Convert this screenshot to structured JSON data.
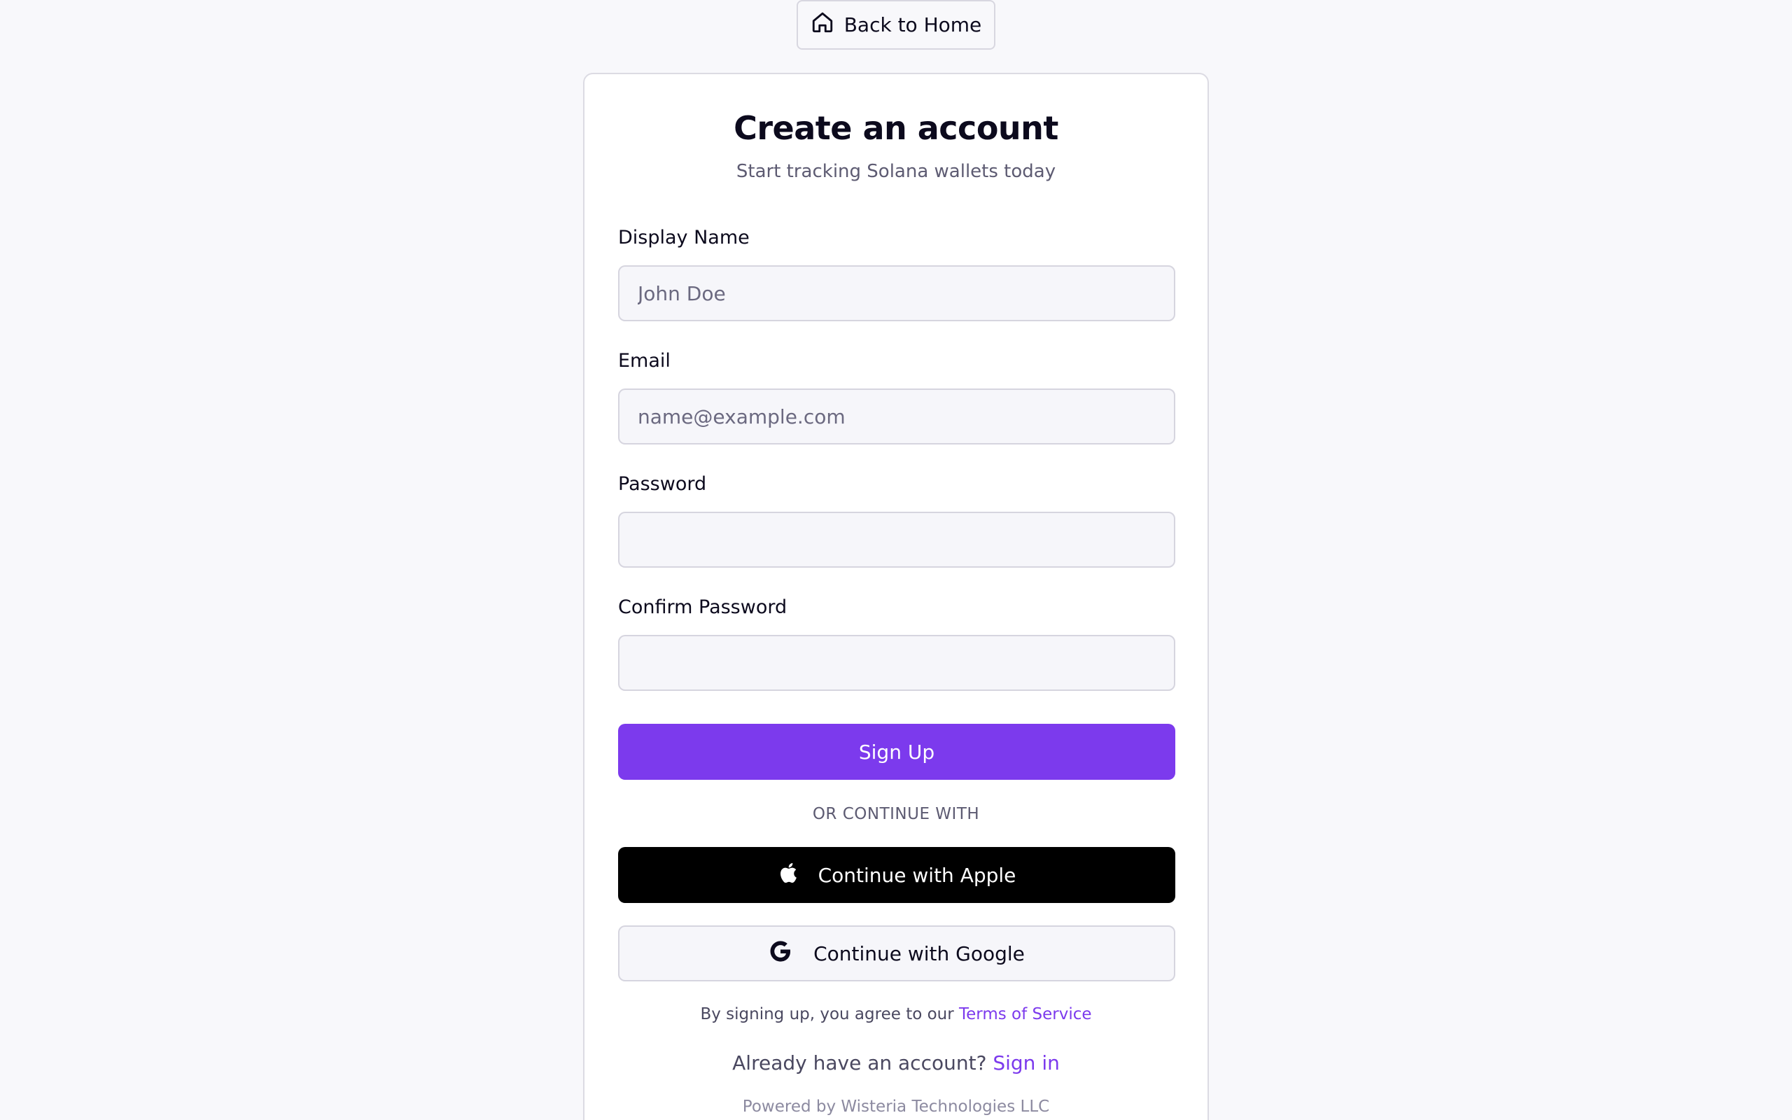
{
  "header": {
    "back_label": "Back to Home",
    "back_icon": "home-icon"
  },
  "card": {
    "title": "Create an account",
    "subtitle": "Start tracking Solana wallets today"
  },
  "form": {
    "display_name": {
      "label": "Display Name",
      "placeholder": "John Doe",
      "value": ""
    },
    "email": {
      "label": "Email",
      "placeholder": "name@example.com",
      "value": ""
    },
    "password": {
      "label": "Password",
      "placeholder": "",
      "value": ""
    },
    "confirm_password": {
      "label": "Confirm Password",
      "placeholder": "",
      "value": ""
    },
    "submit_label": "Sign Up"
  },
  "oauth": {
    "divider": "OR CONTINUE WITH",
    "apple_label": "Continue with Apple",
    "apple_icon": "apple-icon",
    "google_label": "Continue with Google",
    "google_icon": "google-icon"
  },
  "footer": {
    "terms_prefix": "By signing up, you agree to our ",
    "terms_link": "Terms of Service",
    "signin_prefix": "Already have an account? ",
    "signin_link": "Sign in",
    "powered_by": "Powered by Wisteria Technologies LLC"
  },
  "colors": {
    "accent": "#7c3aed",
    "background": "#f8f8fb",
    "card": "#ffffff",
    "apple_button": "#000000"
  }
}
